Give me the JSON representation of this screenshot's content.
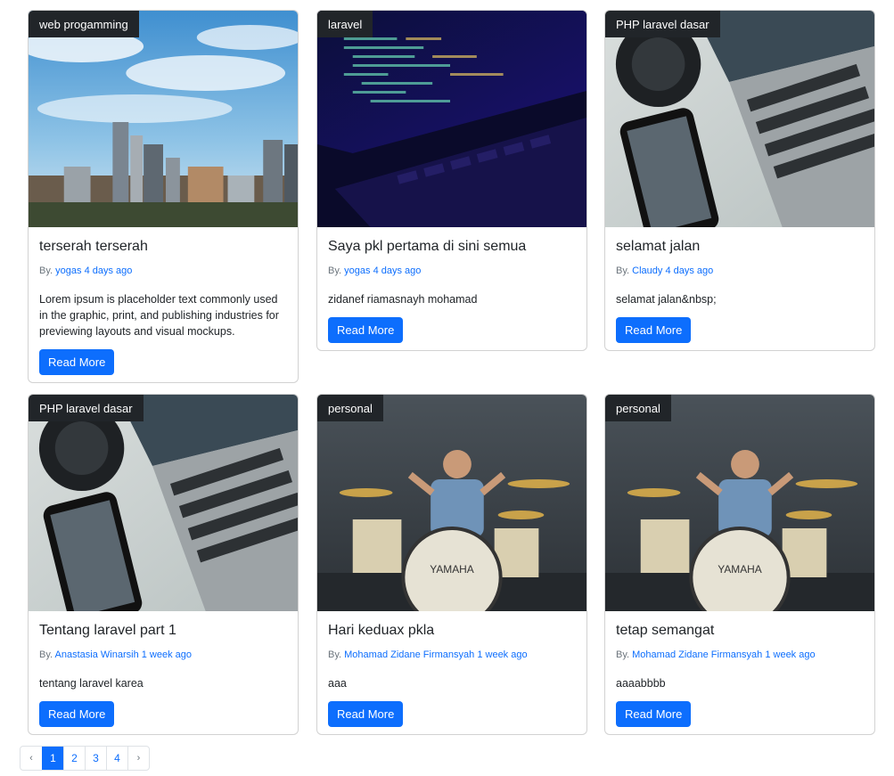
{
  "posts": [
    {
      "category": "web progamming",
      "title": "terserah terserah",
      "by": "By.",
      "author": "yogas",
      "time": "4 days ago",
      "excerpt": "Lorem ipsum is placeholder text commonly used in the graphic, print, and publishing industries for previewing layouts and visual mockups.",
      "button": "Read More",
      "image": "city-skyline"
    },
    {
      "category": "laravel",
      "title": "Saya pkl pertama di sini semua",
      "by": "By.",
      "author": "yogas",
      "time": "4 days ago",
      "excerpt": "zidanef riamasnayh mohamad",
      "button": "Read More",
      "image": "laptop-code"
    },
    {
      "category": "PHP laravel dasar",
      "title": "selamat jalan",
      "by": "By.",
      "author": "Claudy",
      "time": "4 days ago",
      "excerpt": "selamat jalan&nbsp;",
      "button": "Read More",
      "image": "laptop-phone"
    },
    {
      "category": "PHP laravel dasar",
      "title": "Tentang laravel part 1",
      "by": "By.",
      "author": "Anastasia Winarsih",
      "time": "1 week ago",
      "excerpt": "tentang laravel karea",
      "button": "Read More",
      "image": "laptop-phone"
    },
    {
      "category": "personal",
      "title": "Hari keduax pkla",
      "by": "By.",
      "author": "Mohamad Zidane Firmansyah",
      "time": "1 week ago",
      "excerpt": "aaa",
      "button": "Read More",
      "image": "drummer"
    },
    {
      "category": "personal",
      "title": "tetap semangat",
      "by": "By.",
      "author": "Mohamad Zidane Firmansyah",
      "time": "1 week ago",
      "excerpt": "aaaabbbb",
      "button": "Read More",
      "image": "drummer"
    }
  ],
  "pagination": {
    "prev": "‹",
    "pages": [
      "1",
      "2",
      "3",
      "4"
    ],
    "active": "1",
    "next": "›"
  },
  "colors": {
    "primary": "#0d6efd",
    "badge": "#212529",
    "muted": "#6c757d"
  }
}
